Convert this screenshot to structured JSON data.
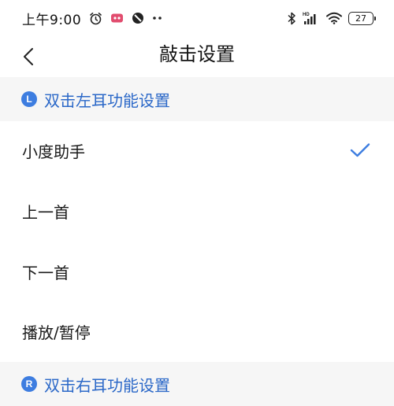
{
  "status_bar": {
    "time": "上午9:00",
    "battery": "27",
    "icons": [
      "alarm-icon",
      "app-notification-icon",
      "do-not-disturb-icon",
      "more-dots-icon",
      "bluetooth-icon",
      "hd-signal-icon",
      "wifi-icon",
      "battery-icon"
    ]
  },
  "nav": {
    "title": "敲击设置",
    "back_icon": "chevron-left-icon"
  },
  "left_section": {
    "badge": "L",
    "title": "双击左耳功能设置",
    "options": [
      {
        "label": "小度助手",
        "selected": true
      },
      {
        "label": "上一首",
        "selected": false
      },
      {
        "label": "下一首",
        "selected": false
      },
      {
        "label": "播放/暂停",
        "selected": false
      }
    ]
  },
  "right_section": {
    "badge": "R",
    "title": "双击右耳功能设置"
  },
  "colors": {
    "accent": "#3d7de0",
    "section_text": "#2b68c8",
    "section_bg": "#f6f6f6"
  }
}
